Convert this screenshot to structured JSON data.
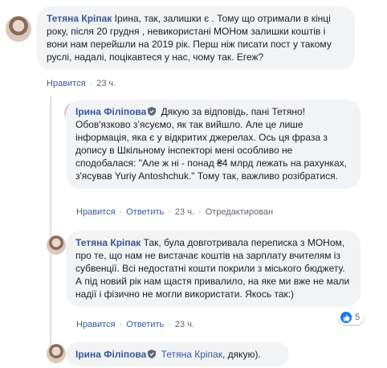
{
  "comments": [
    {
      "author": "Тетяна Кріпак",
      "text": "Ірина, так, залишки є . Тому що отримали в кінці року, після 20 грудня , невикористані МОНом залишки коштів і вони нам перейшли на 2019 рік. Перш ніж писати пост у такому руслі, надалі, поцікавтеся у нас, чому так. Егеж?",
      "like": "Нравится",
      "time": "23 ч."
    },
    {
      "author": "Ірина Філіпова",
      "text": "Дякую за відповідь, пані Тетяно! Обов'язково зʼясуємо, як так вийшло. Але це лише інформація, яка є у відкритих джерелах. Ось ця фраза з допису в Шкільному інспекторі мені особливо не сподобалася: \"Але ж ні - понад ₴4 млрд лежать на рахунках, з'ясував Yuriy Antoshchuk.\" Тому так, важливо розібратися.",
      "like": "Нравится",
      "reply": "Ответить",
      "time": "23 ч.",
      "edited": "Отредактирован"
    },
    {
      "author": "Тетяна Кріпак",
      "text": "Так, була довготривала переписка з МОНом, про те, що нам не вистачає коштів на зарплату вчителям із субвенції. Всі недостатні кошти покрили з міського бюджету. А під новий рік нам щастя привалило, на яке ми вже не мали надії і фізично не могли використати. Якось так:)",
      "like": "Нравится",
      "reply": "Ответить",
      "time": "23 ч.",
      "reactions_count": "5"
    },
    {
      "author": "Ірина Філіпова",
      "mention": "Тетяна Кріпак",
      "text": ", дякую)."
    }
  ],
  "colors": {
    "link": "#385898",
    "bubble": "#f2f3f5",
    "meta": "#606770",
    "like": "#1877f2"
  }
}
